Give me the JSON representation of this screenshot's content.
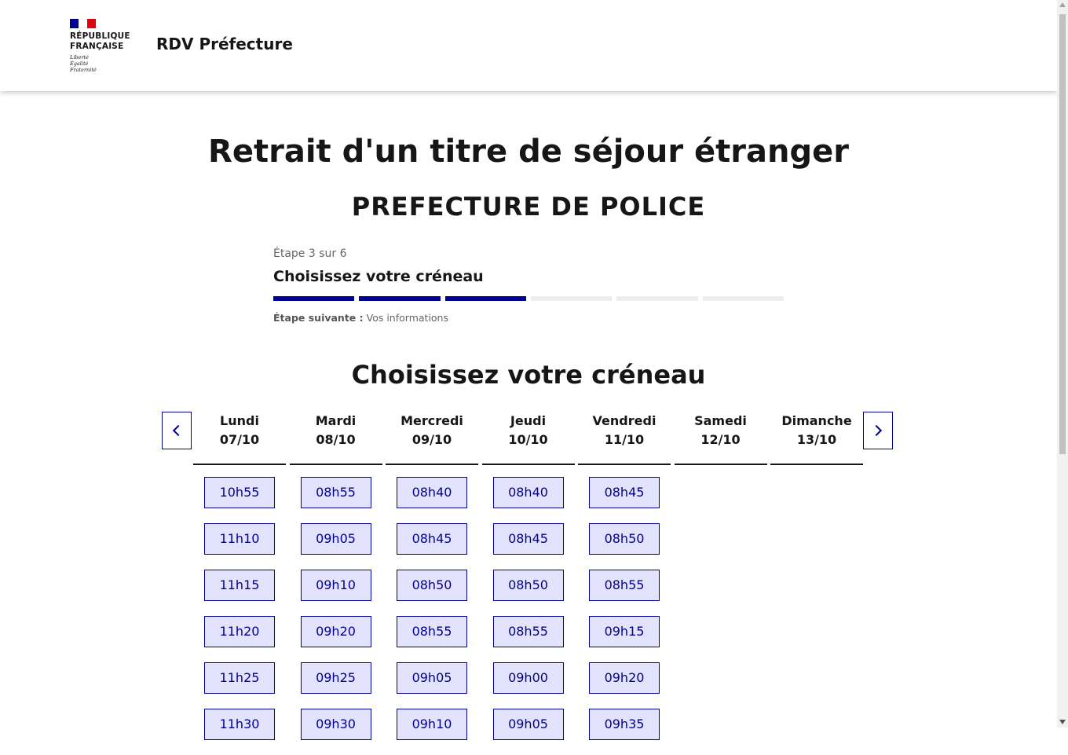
{
  "header": {
    "logo_line1": "RÉPUBLIQUE",
    "logo_line2": "FRANÇAISE",
    "motto": [
      "Liberté",
      "Égalité",
      "Fraternité"
    ],
    "service_name": "RDV Préfecture"
  },
  "page": {
    "title": "Retrait d'un titre de séjour étranger",
    "subtitle": "PREFECTURE DE POLICE"
  },
  "stepper": {
    "state": "Étape 3 sur 6",
    "title": "Choisissez votre créneau",
    "current_step": 3,
    "total_steps": 6,
    "next_label": "Étape suivante :",
    "next_value": "Vos informations"
  },
  "calendar": {
    "heading": "Choisissez votre créneau",
    "days": [
      {
        "name": "Lundi",
        "date": "07/10",
        "slots": [
          "10h55",
          "11h10",
          "11h15",
          "11h20",
          "11h25",
          "11h30"
        ]
      },
      {
        "name": "Mardi",
        "date": "08/10",
        "slots": [
          "08h55",
          "09h05",
          "09h10",
          "09h20",
          "09h25",
          "09h30"
        ]
      },
      {
        "name": "Mercredi",
        "date": "09/10",
        "slots": [
          "08h40",
          "08h45",
          "08h50",
          "08h55",
          "09h05",
          "09h10"
        ]
      },
      {
        "name": "Jeudi",
        "date": "10/10",
        "slots": [
          "08h40",
          "08h45",
          "08h50",
          "08h55",
          "09h00",
          "09h05"
        ]
      },
      {
        "name": "Vendredi",
        "date": "11/10",
        "slots": [
          "08h45",
          "08h50",
          "08h55",
          "09h15",
          "09h20",
          "09h35"
        ]
      },
      {
        "name": "Samedi",
        "date": "12/10",
        "slots": []
      },
      {
        "name": "Dimanche",
        "date": "13/10",
        "slots": []
      }
    ]
  },
  "colors": {
    "accent": "#000091",
    "slot_bg": "#e3e3fd",
    "flag_blue": "#000091",
    "flag_white": "#ffffff",
    "flag_red": "#e1000f"
  },
  "icons": {
    "prev": "chevron-left-icon",
    "next": "chevron-right-icon"
  }
}
